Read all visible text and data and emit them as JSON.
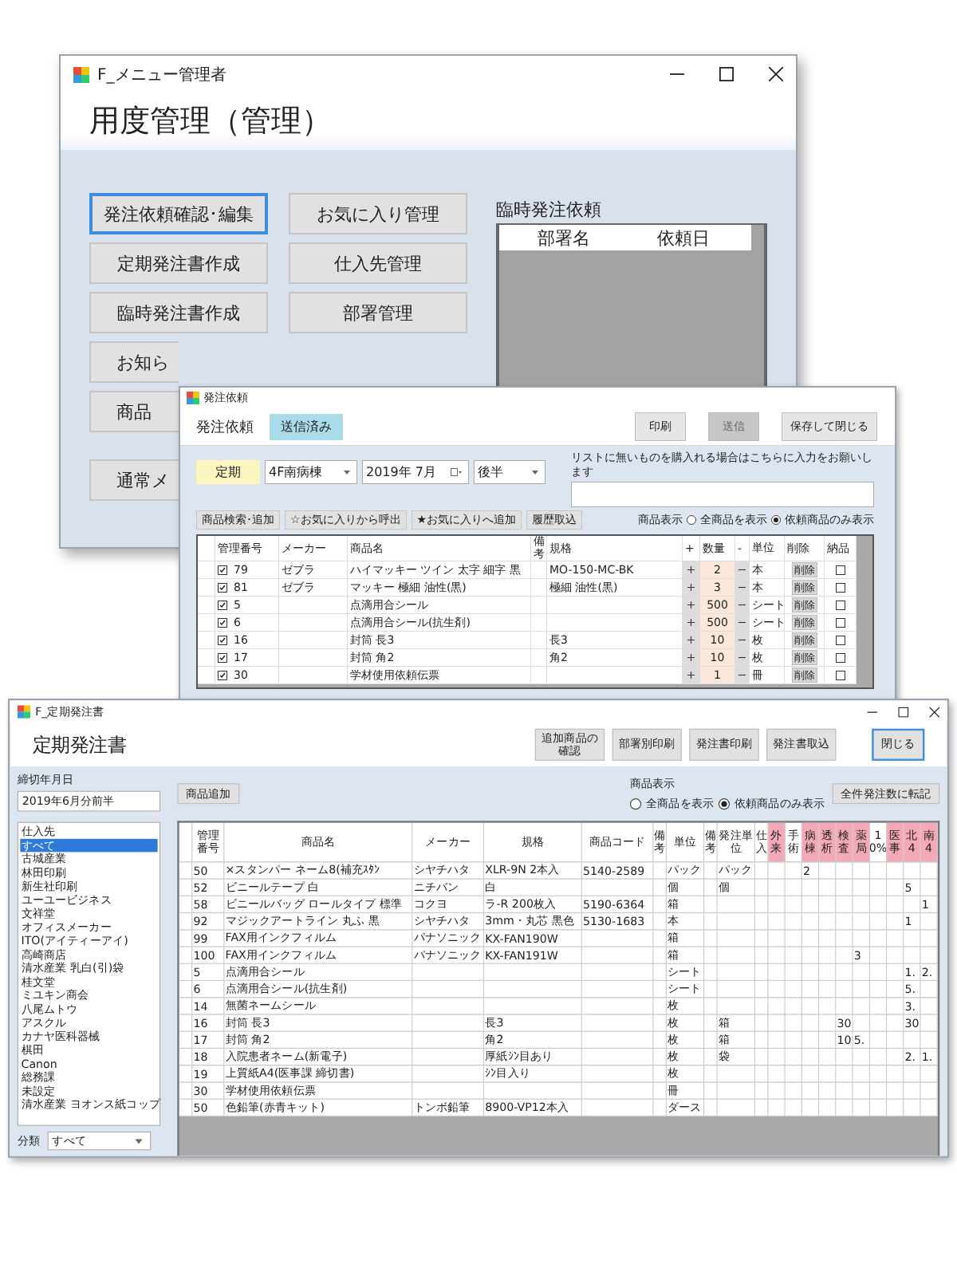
{
  "menu_window": {
    "title": "F_メニュー管理者",
    "heading": "用度管理（管理）",
    "left_buttons": [
      {
        "label": "発注依頼確認･編集",
        "selected": true
      },
      {
        "label": "定期発注書作成",
        "selected": false
      },
      {
        "label": "臨時発注書作成",
        "selected": false
      },
      {
        "label": "お知ら",
        "selected": false
      },
      {
        "label": "商品",
        "selected": false
      },
      {
        "label": "通常メ",
        "selected": false
      }
    ],
    "right_buttons": [
      {
        "label": "お気に入り管理",
        "selected": false
      },
      {
        "label": "仕入先管理",
        "selected": false
      },
      {
        "label": "部署管理",
        "selected": false
      }
    ],
    "temp_requests": {
      "title": "臨時発注依頼",
      "columns": [
        "部署名",
        "依頼日"
      ]
    }
  },
  "order_window": {
    "title": "発注依頼",
    "heading": "発注依頼",
    "status_badge": "送信済み",
    "actions": [
      {
        "label": "印刷",
        "disabled": false
      },
      {
        "label": "送信",
        "disabled": true
      },
      {
        "label": "保存して閉じる",
        "disabled": false
      }
    ],
    "type_label": "定期",
    "ward": "4F南病棟",
    "month": "2019年 7月",
    "half": "後半",
    "note_label": "リストに無いものを購入れる場合はこちらに入力をお願いします",
    "tools": [
      "商品検索･追加",
      "☆お気に入りから呼出",
      "★お気に入りへ追加",
      "履歴取込"
    ],
    "display": {
      "label": "商品表示",
      "options": [
        {
          "label": "全商品を表示",
          "selected": false
        },
        {
          "label": "依頼商品のみ表示",
          "selected": true
        }
      ]
    },
    "columns": [
      "管理番号",
      "メーカー",
      "商品名",
      "備考",
      "規格",
      "+",
      "数量",
      "-",
      "単位",
      "削除",
      "納品"
    ],
    "rows": [
      {
        "checked": true,
        "id": "79",
        "maker": "ゼブラ",
        "name": "ハイマッキー ツイン 太字 細字 黒",
        "spec": "MO-150-MC-BK",
        "qty": "2",
        "unit": "本",
        "delete": "削除",
        "delivered": false
      },
      {
        "checked": true,
        "id": "81",
        "maker": "ゼブラ",
        "name": "マッキー 極細 油性(黒)",
        "spec": "極細 油性(黒)",
        "qty": "3",
        "unit": "本",
        "delete": "削除",
        "delivered": false
      },
      {
        "checked": true,
        "id": "5",
        "name": "点滴用合シール",
        "qty": "500",
        "unit": "シート",
        "delete": "削除",
        "delivered": false
      },
      {
        "checked": true,
        "id": "6",
        "name": "点滴用合シール(抗生剤)",
        "qty": "500",
        "unit": "シート",
        "delete": "削除",
        "delivered": false
      },
      {
        "checked": true,
        "id": "16",
        "name": "封筒 長3",
        "spec": "長3",
        "qty": "10",
        "unit": "枚",
        "delete": "削除",
        "delivered": false
      },
      {
        "checked": true,
        "id": "17",
        "name": "封筒 角2",
        "spec": "角2",
        "qty": "10",
        "unit": "枚",
        "delete": "削除",
        "delivered": false
      },
      {
        "checked": true,
        "id": "30",
        "name": "学材使用依頼伝票",
        "qty": "1",
        "unit": "冊",
        "delete": "削除",
        "delivered": false
      }
    ]
  },
  "periodic_window": {
    "title": "F_定期発注書",
    "heading": "定期発注書",
    "actions": [
      {
        "label": "追加商品の確認",
        "selected": false
      },
      {
        "label": "部署別印刷",
        "selected": false
      },
      {
        "label": "発注書印刷",
        "selected": false
      },
      {
        "label": "発注書取込",
        "selected": false
      },
      {
        "label": "閉じる",
        "selected": true
      }
    ],
    "deadline": {
      "label": "締切年月日",
      "value": "2019年6月分前半"
    },
    "suppliers": [
      {
        "label": "仕入先",
        "selected": false
      },
      {
        "label": "すべて",
        "selected": true
      },
      {
        "label": "古城産業",
        "selected": false
      },
      {
        "label": "林田印刷",
        "selected": false
      },
      {
        "label": "新生社印刷",
        "selected": false
      },
      {
        "label": "ユーユービジネス",
        "selected": false
      },
      {
        "label": "文祥堂",
        "selected": false
      },
      {
        "label": "オフィスメーカー",
        "selected": false
      },
      {
        "label": "ITO(アイティーアイ)",
        "selected": false
      },
      {
        "label": "高崎商店",
        "selected": false
      },
      {
        "label": "清水産業 乳白(引)袋",
        "selected": false
      },
      {
        "label": "桂文堂",
        "selected": false
      },
      {
        "label": "ミユキン商会",
        "selected": false
      },
      {
        "label": "八尾ムトウ",
        "selected": false
      },
      {
        "label": "アスクル",
        "selected": false
      },
      {
        "label": "カナヤ医科器械",
        "selected": false
      },
      {
        "label": "棋田",
        "selected": false
      },
      {
        "label": "Canon",
        "selected": false
      },
      {
        "label": "総務課",
        "selected": false
      },
      {
        "label": "未設定",
        "selected": false
      },
      {
        "label": "清水産業 ヨオンス紙コップ",
        "selected": false
      }
    ],
    "category": {
      "label": "分類",
      "value": "すべて"
    },
    "add_button": "商品追加",
    "display": {
      "label": "商品表示",
      "options": [
        {
          "label": "全商品を表示",
          "selected": false
        },
        {
          "label": "依頼商品のみ表示",
          "selected": true
        }
      ]
    },
    "transfer_button": "全件発注数に転記",
    "columns": [
      {
        "label": "管理番号",
        "highlighted": false
      },
      {
        "label": "商品名",
        "highlighted": false
      },
      {
        "label": "メーカー",
        "highlighted": false
      },
      {
        "label": "規格",
        "highlighted": false
      },
      {
        "label": "商品コード",
        "highlighted": false
      },
      {
        "label": "備考",
        "highlighted": false
      },
      {
        "label": "単位",
        "highlighted": false
      },
      {
        "label": "備考",
        "highlighted": false
      },
      {
        "label": "発注単位",
        "highlighted": false
      },
      {
        "label": "仕入",
        "highlighted": false
      },
      {
        "label": "外来",
        "highlighted": true
      },
      {
        "label": "手術",
        "highlighted": false
      },
      {
        "label": "病棟",
        "highlighted": true
      },
      {
        "label": "透析",
        "highlighted": true
      },
      {
        "label": "検査",
        "highlighted": true
      },
      {
        "label": "薬局",
        "highlighted": true
      },
      {
        "label": "10%",
        "highlighted": false
      },
      {
        "label": "医事",
        "highlighted": true
      },
      {
        "label": "北4",
        "highlighted": true
      },
      {
        "label": "南4",
        "highlighted": true
      }
    ],
    "rows": [
      [
        "50",
        "×スタンパー ネーム8(補充ｽﾀﾝ",
        "シヤチハタ",
        "XLR-9N 2本入",
        "5140-2589",
        null,
        "パック",
        null,
        "パック",
        null,
        null,
        null,
        "2",
        null,
        null,
        null,
        null,
        null,
        null,
        null
      ],
      [
        "52",
        "ビニールテープ 白",
        "ニチバン",
        "白",
        null,
        null,
        "個",
        null,
        "個",
        null,
        null,
        null,
        null,
        null,
        null,
        null,
        null,
        null,
        "5",
        null
      ],
      [
        "58",
        "ビニールバッグ ロールタイプ 標準",
        "コクヨ",
        "ラ-R 200枚入",
        "5190-6364",
        null,
        "箱",
        null,
        null,
        null,
        null,
        null,
        null,
        null,
        null,
        null,
        null,
        null,
        null,
        "1"
      ],
      [
        "92",
        "マジックアートライン 丸ふ 黒",
        "シヤチハタ",
        "3mm・丸芯 黒色",
        "5130-1683",
        null,
        "本",
        null,
        null,
        null,
        null,
        null,
        null,
        null,
        null,
        null,
        null,
        null,
        "1",
        null
      ],
      [
        "99",
        "FAX用インクフィルム",
        "パナソニック",
        "KX-FAN190W",
        null,
        null,
        "箱",
        null,
        null,
        null,
        null,
        null,
        null,
        null,
        null,
        null,
        null,
        null,
        null,
        null
      ],
      [
        "100",
        "FAX用インクフィルム",
        "パナソニック",
        "KX-FAN191W",
        null,
        null,
        "箱",
        null,
        null,
        null,
        null,
        null,
        null,
        null,
        null,
        "3",
        null,
        null,
        null,
        null
      ],
      [
        "5",
        "点滴用合シール",
        null,
        null,
        null,
        null,
        "シート",
        null,
        null,
        null,
        null,
        null,
        null,
        null,
        null,
        null,
        null,
        null,
        "1.",
        "2."
      ],
      [
        "6",
        "点滴用合シール(抗生剤)",
        null,
        null,
        null,
        null,
        "シート",
        null,
        null,
        null,
        null,
        null,
        null,
        null,
        null,
        null,
        null,
        null,
        "5.",
        null
      ],
      [
        "14",
        "無菌ネームシール",
        null,
        null,
        null,
        null,
        "枚",
        null,
        null,
        null,
        null,
        null,
        null,
        null,
        null,
        null,
        null,
        null,
        "3.",
        null
      ],
      [
        "16",
        "封筒 長3",
        null,
        "長3",
        null,
        null,
        "枚",
        null,
        "箱",
        null,
        null,
        null,
        null,
        null,
        "30",
        null,
        null,
        null,
        "30",
        null
      ],
      [
        "17",
        "封筒 角2",
        null,
        "角2",
        null,
        null,
        "枚",
        null,
        "箱",
        null,
        null,
        null,
        null,
        null,
        "10",
        "5.",
        null,
        null,
        null,
        null
      ],
      [
        "18",
        "入院患者ネーム(新電子)",
        null,
        "厚紙ｼﾝ目あり",
        null,
        null,
        "枚",
        null,
        "袋",
        null,
        null,
        null,
        null,
        null,
        null,
        null,
        null,
        null,
        "2.",
        "1."
      ],
      [
        "19",
        "上質紙A4(医事課 締切書)",
        null,
        "ｼﾝ目入り",
        null,
        null,
        "枚",
        null,
        null,
        null,
        null,
        null,
        null,
        null,
        null,
        null,
        null,
        null,
        null,
        null
      ],
      [
        "30",
        "学材使用依頼伝票",
        null,
        null,
        null,
        null,
        "冊",
        null,
        null,
        null,
        null,
        null,
        null,
        null,
        null,
        null,
        null,
        null,
        null,
        null
      ],
      [
        "50",
        "色鉛筆(赤青キット)",
        "トンボ鉛筆",
        "8900-VP12本入",
        null,
        null,
        "ダース",
        null,
        null,
        null,
        null,
        null,
        null,
        null,
        null,
        null,
        null,
        null,
        null,
        null
      ]
    ]
  }
}
